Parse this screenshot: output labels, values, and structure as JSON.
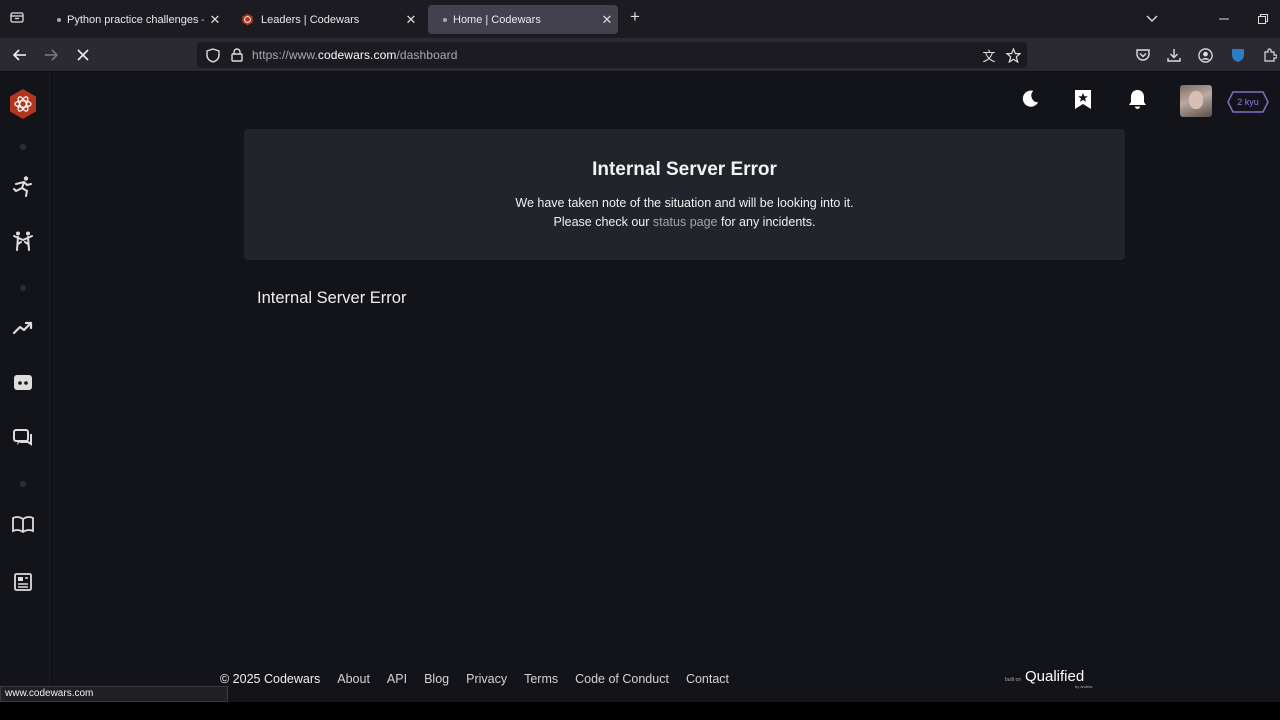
{
  "browser": {
    "tabs": [
      {
        "title": "Python practice challenges – tra",
        "active": false,
        "favicon": "dot"
      },
      {
        "title": "Leaders | Codewars",
        "active": false,
        "favicon": "codewars-logo"
      },
      {
        "title": "Home | Codewars",
        "active": true,
        "favicon": "dot"
      }
    ],
    "url": {
      "prefix": "https://www.",
      "host": "codewars.com",
      "path": "/dashboard"
    },
    "status_url": "www.codewars.com"
  },
  "sidebar": {
    "items": [
      "practice-kata-icon",
      "dojo-icon",
      "leaderboards-icon",
      "discord-icon",
      "forum-icon",
      "docs-icon",
      "blog-icon"
    ]
  },
  "header": {
    "rank": "2 kyu",
    "icons": [
      "moon-icon",
      "bookmark-icon",
      "bell-icon"
    ]
  },
  "error": {
    "title": "Internal Server Error",
    "line1": "We have taken note of the situation and will be looking into it.",
    "line2_before": "Please check our ",
    "line2_link": "status page",
    "line2_after": " for any incidents.",
    "subtitle": "Internal Server Error"
  },
  "footer": {
    "copyright": "© 2025 Codewars",
    "links": [
      "About",
      "API",
      "Blog",
      "Privacy",
      "Terms",
      "Code of Conduct",
      "Contact"
    ],
    "built_on": "built on",
    "qualified": "Qualified",
    "by": "by andela"
  },
  "colors": {
    "brand": "#b1361e",
    "rank": "#866cc7",
    "page_bg": "#131419",
    "panel_bg": "#22242b"
  }
}
